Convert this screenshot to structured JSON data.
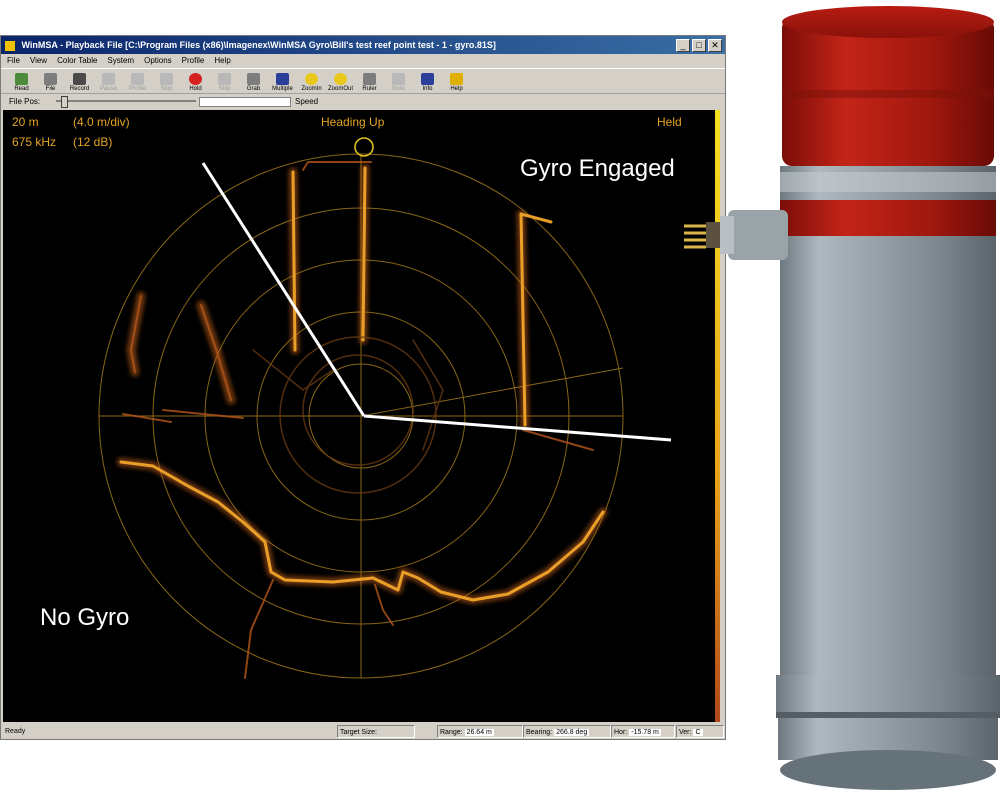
{
  "window": {
    "title": "WinMSA - Playback File [C:\\Program Files (x86)\\Imagenex\\WinMSA Gyro\\Bill's test reef point test - 1 - gyro.81S]",
    "controls": [
      "_",
      "□",
      "✕"
    ]
  },
  "menu": [
    "File",
    "View",
    "Color Table",
    "System",
    "Options",
    "Profile",
    "Help"
  ],
  "toolbar": [
    {
      "label": "Read",
      "icon": "read-icon",
      "color": "green",
      "enabled": true
    },
    {
      "label": "File",
      "icon": "file-icon",
      "color": "gray",
      "enabled": true
    },
    {
      "label": "Record",
      "icon": "record-icon",
      "color": "dgray",
      "enabled": true
    },
    {
      "label": "Pause",
      "icon": "pause-icon",
      "color": "light",
      "enabled": false
    },
    {
      "label": "Profile",
      "icon": "profile-icon",
      "color": "light",
      "enabled": false
    },
    {
      "label": "Stop",
      "icon": "stop-icon",
      "color": "light",
      "enabled": false
    },
    {
      "label": "Hold",
      "icon": "hold-icon",
      "color": "red",
      "enabled": true
    },
    {
      "label": "Skip",
      "icon": "skip-icon",
      "color": "light",
      "enabled": false
    },
    {
      "label": "Grab",
      "icon": "grab-icon",
      "color": "gray",
      "enabled": true
    },
    {
      "label": "Multiple",
      "icon": "multiple-icon",
      "color": "blue",
      "enabled": true
    },
    {
      "label": "ZoomIn",
      "icon": "zoom-in-icon",
      "color": "yellow",
      "enabled": true
    },
    {
      "label": "ZoomOut",
      "icon": "zoom-out-icon",
      "color": "yellow",
      "enabled": true
    },
    {
      "label": "Ruler",
      "icon": "ruler-icon",
      "color": "gray",
      "enabled": true
    },
    {
      "label": "Note",
      "icon": "note-icon",
      "color": "light",
      "enabled": false
    },
    {
      "label": "Info",
      "icon": "info-icon",
      "color": "blue",
      "enabled": true
    },
    {
      "label": "Help",
      "icon": "help-icon",
      "color": "help",
      "enabled": true
    }
  ],
  "file_pos": {
    "label": "File Pos:",
    "speed_label": "Speed"
  },
  "sonar": {
    "range": "20 m",
    "scale": "(4.0 m/div)",
    "frequency": "675 kHz",
    "gain": "(12 dB)",
    "orientation": "Heading Up",
    "mode": "Held",
    "colors": {
      "overlay": "#e3a322",
      "grid": "#a07a1a",
      "echo": "#d27a1e",
      "background": "#000000"
    }
  },
  "annotations": {
    "gyro_engaged": "Gyro Engaged",
    "no_gyro": "No Gyro"
  },
  "status": {
    "ready": "Ready",
    "target_size": "Target Size:",
    "range_label": "Range:",
    "range_value": "26.64 m",
    "bearing_label": "Bearing:",
    "bearing_value": "266.8 deg",
    "hor_label": "Hor:",
    "hor_value": "-15.78 m",
    "ver_label": "Ver:",
    "ver_value": "C"
  },
  "device": {
    "icon": "sonar-head-icon",
    "body_color": "#8e9aa2",
    "cap_color": "#b31b10"
  }
}
